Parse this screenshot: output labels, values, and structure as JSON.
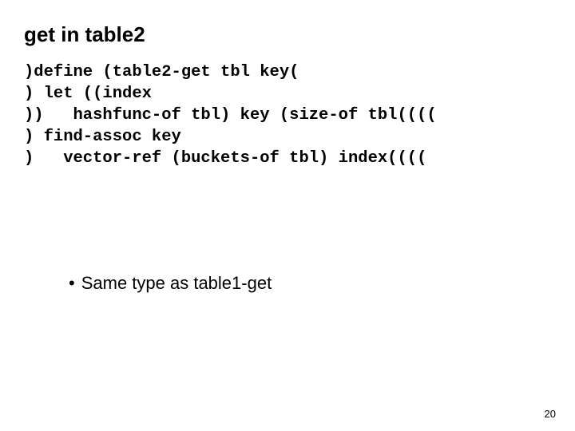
{
  "title": "get in table2",
  "code_lines": [
    ")define (table2-get tbl key(",
    ") let ((index",
    "))   hashfunc-of tbl) key (size-of tbl((((",
    ") find-assoc key",
    ")   vector-ref (buckets-of tbl) index(((("
  ],
  "bullet": "Same type as table1-get",
  "page_number": "20"
}
